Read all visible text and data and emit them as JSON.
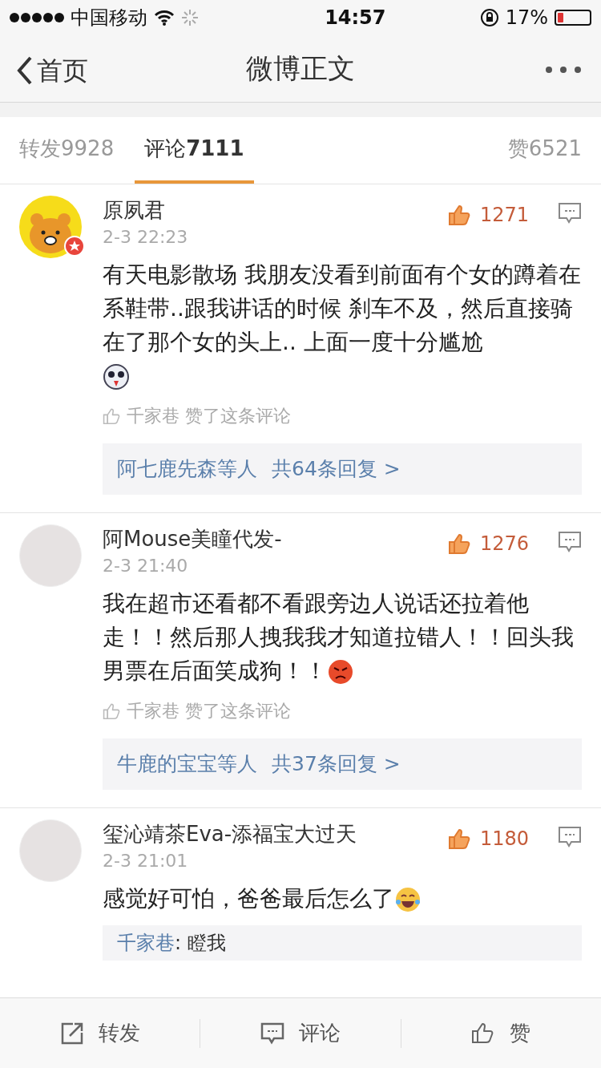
{
  "status_bar": {
    "carrier": "中国移动",
    "time": "14:57",
    "battery": "17%"
  },
  "nav": {
    "back_label": "首页",
    "title": "微博正文"
  },
  "tabs": [
    {
      "label": "转发",
      "count": "9928",
      "selected": false
    },
    {
      "label": "评论",
      "count": "7111",
      "selected": true
    },
    {
      "label": "赞",
      "count": "6521",
      "selected": false
    }
  ],
  "comments": [
    {
      "name": "原夙君",
      "verified": true,
      "avatar": {
        "kind": "bear"
      },
      "time": "2-3 22:23",
      "likes": "1271",
      "text": "有天电影散场 我朋友没看到前面有个女的蹲着在系鞋带..跟我讲话的时候 刹车不及，然后直接骑在了那个女的头上.. 上面一度十分尴尬",
      "emoji": {
        "kind": "husky",
        "newline": true
      },
      "liked_by": {
        "user": "千家巷",
        "text": "赞了这条评论"
      },
      "replies": {
        "users": "阿七鹿先森等人",
        "count": "共64条回复 >"
      }
    },
    {
      "name": "阿Mouse美瞳代发-",
      "verified": false,
      "avatar": {
        "kind": "photo"
      },
      "time": "2-3 21:40",
      "likes": "1276",
      "text": "我在超市还看都不看跟旁边人说话还拉着他走！！然后那人拽我我才知道拉错人！！回头我男票在后面笑成狗！！",
      "emoji": {
        "kind": "angry",
        "newline": false
      },
      "liked_by": {
        "user": "千家巷",
        "text": "赞了这条评论"
      },
      "replies": {
        "users": "牛鹿的宝宝等人",
        "count": "共37条回复 >"
      }
    },
    {
      "name": "玺沁靖茶Eva-添福宝大过天",
      "verified": false,
      "avatar": {
        "kind": "photo"
      },
      "time": "2-3 21:01",
      "likes": "1180",
      "text": "感觉好可怕，爸爸最后怎么了",
      "emoji": {
        "kind": "laugh",
        "newline": false
      },
      "reply_preview": {
        "author": "千家巷",
        "text": ": 瞪我"
      }
    }
  ],
  "actions": [
    {
      "kind": "share",
      "label": "转发"
    },
    {
      "kind": "comment",
      "label": "评论"
    },
    {
      "kind": "like",
      "label": "赞"
    }
  ]
}
